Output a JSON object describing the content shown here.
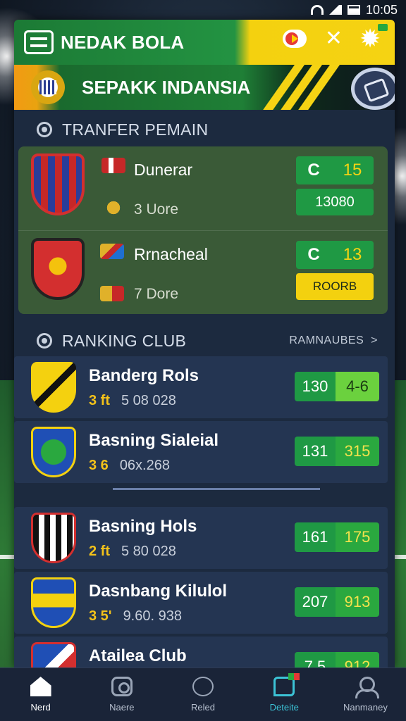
{
  "status_bar": {
    "time": "10:05"
  },
  "header": {
    "app_title": "NEDAK BOLA"
  },
  "hero": {
    "title": "SEPAKK INDANSIA"
  },
  "transfer": {
    "section_title": "TRANFER PEMAIN",
    "items": [
      {
        "name": "Dunerar",
        "sub": "3 Uore",
        "score_left": "C",
        "score_right": "15",
        "action": "13080",
        "action_style": "green"
      },
      {
        "name": "Rrnacheal",
        "sub": "7 Dore",
        "score_left": "C",
        "score_right": "13",
        "action": "ROORB",
        "action_style": "yellow"
      }
    ]
  },
  "ranking": {
    "section_title": "RANKING CLUB",
    "more_label": "RAMNAUBES",
    "clubs": [
      {
        "name": "Banderg Rols",
        "num": "3 ft",
        "stat": "5 08 028",
        "score_a": "130",
        "score_b": "4-6",
        "style": "light"
      },
      {
        "name": "Basning Sialeial",
        "num": "3 6",
        "stat": "06x.268",
        "score_a": "131",
        "score_b": "315",
        "style": "dark"
      },
      {
        "name": "Basning Hols",
        "num": "2 ft",
        "stat": "5 80 028",
        "score_a": "161",
        "score_b": "175",
        "style": "dark"
      },
      {
        "name": "Dasnbang Kilulol",
        "num": "3 5'",
        "stat": "9.60. 938",
        "score_a": "207",
        "score_b": "913",
        "style": "dark"
      },
      {
        "name": "Atailea Club",
        "num": "",
        "stat": "",
        "score_a": "7.5",
        "score_b": "912",
        "style": "dark"
      }
    ]
  },
  "bottom_nav": [
    {
      "label": "Nerd",
      "icon": "home-icon"
    },
    {
      "label": "Naere",
      "icon": "camera-icon"
    },
    {
      "label": "Reled",
      "icon": "clock-icon"
    },
    {
      "label": "Deteite",
      "icon": "chat-icon"
    },
    {
      "label": "Nanmaney",
      "icon": "user-icon"
    }
  ]
}
